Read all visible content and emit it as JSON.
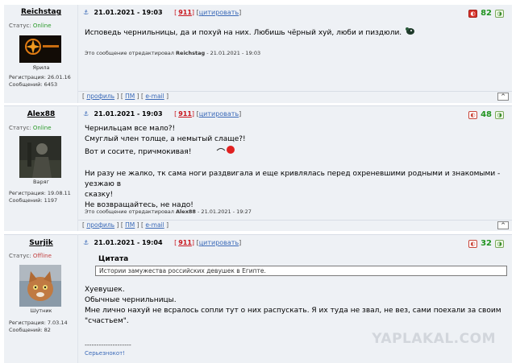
{
  "posts": [
    {
      "nick": "Reichstag",
      "status_label": "Статус:",
      "status": "Online",
      "avatar_caption": "Ярила",
      "reg": "Регистрация: 26.01.16",
      "msgs": "Сообщений: 6453",
      "date": "21.01.2021 - 19:03",
      "number": "911",
      "cite": "цитировать",
      "score": "82",
      "body_lines": [
        "Исповедь чернильницы, да и похуй на них. Любишь чёрный хуй, люби и пиздюли."
      ],
      "edited_prefix": "Это сообщение отредактировал",
      "edited_by": "Reichstag",
      "edited_date": "- 21.01.2021 - 19:03",
      "foot": {
        "profile": "профиль",
        "pm": "ПМ",
        "email": "e-mail",
        "up": "^"
      }
    },
    {
      "nick": "Alex88",
      "status_label": "Статус:",
      "status": "Online",
      "avatar_caption": "Варяг",
      "reg": "Регистрация: 19.08.11",
      "msgs": "Сообщений: 1197",
      "date": "21.01.2021 - 19:03",
      "number": "911",
      "cite": "цитировать",
      "score": "48",
      "body_lines": [
        "Чернильцам все мало?!",
        "Смуглый член толще, а немытый слаще?!",
        "Вот и сосите, причмокивая!",
        "",
        "Ни разу не жалко, тк сама ноги раздвигала и еще кривлялась перед охреневшими родными и знакомыми - уезжаю в",
        "сказку!",
        "Не возвращайтесь, не надо!"
      ],
      "edited_prefix": "Это сообщение отредактировал",
      "edited_by": "Alex88",
      "edited_date": "- 21.01.2021 - 19:27",
      "foot": {
        "profile": "профиль",
        "pm": "ПМ",
        "email": "e-mail",
        "up": "^"
      }
    },
    {
      "nick": "Surjik",
      "status_label": "Статус:",
      "status": "Offline",
      "avatar_caption": "Шутник",
      "reg": "Регистрация: 7.03.14",
      "msgs": "Сообщений: 82",
      "date": "21.01.2021 - 19:04",
      "number": "911",
      "cite": "цитировать",
      "score": "32",
      "quote_title": "Цитата",
      "quote_text": "Истории замужества российских девушек в Египте.",
      "body_lines": [
        "Хуевушек.",
        "Обычные чернильницы.",
        "Мне лично нахуй не всралось сопли тут о них распускать. Я их туда не звал, не вез, сами поехали за своим",
        "\"счастьем\"."
      ],
      "sig_line": "--------------------",
      "signature": "Серьезнокот!"
    }
  ],
  "watermark": "YAPLAKAL.COM",
  "colors": {
    "online": "#2a9a2a",
    "offline": "#c24040",
    "score": "#219421",
    "link": "#3b6ab8",
    "number": "#c8141c"
  }
}
